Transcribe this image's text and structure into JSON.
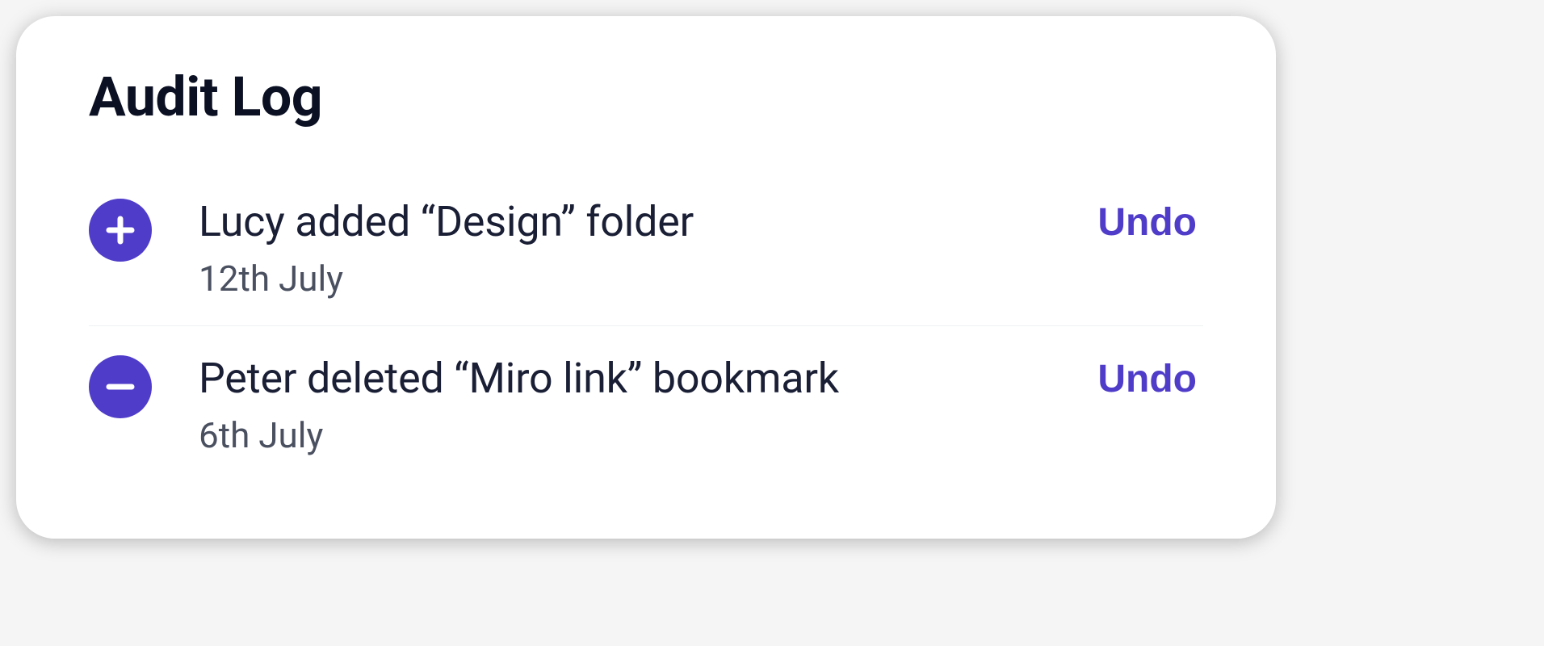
{
  "title": "Audit Log",
  "undo_label": "Undo",
  "colors": {
    "accent": "#4f3cc9",
    "text_primary": "#0b1023",
    "text_body": "#1a1f36",
    "text_muted": "#4a5060"
  },
  "entries": [
    {
      "icon": "plus-icon",
      "description": "Lucy added “Design” folder",
      "date": "12th July"
    },
    {
      "icon": "minus-icon",
      "description": "Peter deleted “Miro link” bookmark",
      "date": "6th July"
    }
  ]
}
